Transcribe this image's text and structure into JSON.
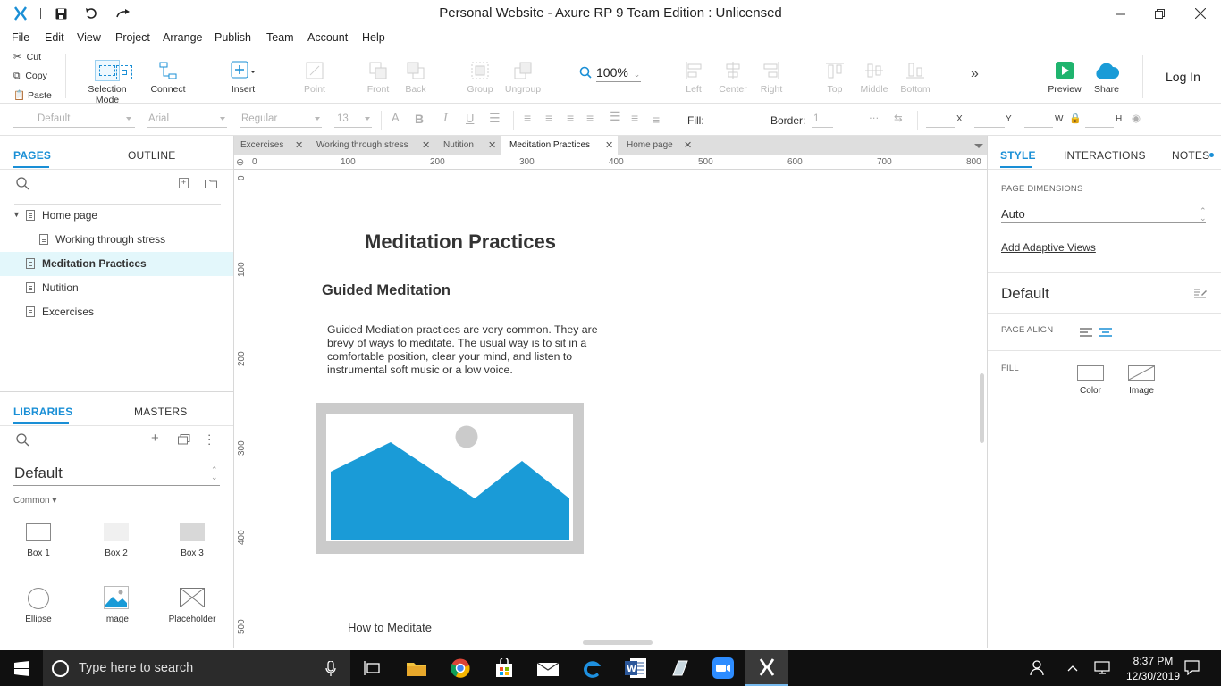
{
  "window": {
    "title": "Personal Website - Axure RP 9 Team Edition : Unlicensed",
    "app_logo": "axure-x-logo",
    "quick_access": [
      "save-icon",
      "undo-icon",
      "redo-icon"
    ],
    "controls": [
      "minimize",
      "restore",
      "close"
    ]
  },
  "menu": [
    "File",
    "Edit",
    "View",
    "Project",
    "Arrange",
    "Publish",
    "Team",
    "Account",
    "Help"
  ],
  "toolbar": {
    "edit": {
      "cut": "Cut",
      "copy": "Copy",
      "paste": "Paste"
    },
    "selection_mode": "Selection Mode",
    "connect": "Connect",
    "insert": "Insert",
    "point": "Point",
    "front": "Front",
    "back": "Back",
    "group": "Group",
    "ungroup": "Ungroup",
    "zoom": "100%",
    "left": "Left",
    "center": "Center",
    "right": "Right",
    "top": "Top",
    "middle": "Middle",
    "bottom": "Bottom",
    "more": "»",
    "preview": "Preview",
    "share": "Share",
    "login": "Log In"
  },
  "format": {
    "style": "Default",
    "font": "Arial",
    "weight": "Regular",
    "size": "13",
    "fill_label": "Fill:",
    "border_label": "Border:",
    "border_value": "1",
    "x": "X",
    "y": "Y",
    "w": "W",
    "h": "H"
  },
  "pages_panel": {
    "tab_pages": "PAGES",
    "tab_outline": "OUTLINE",
    "pages": [
      {
        "label": "Home page",
        "selected": false
      },
      {
        "label": "Working through stress",
        "selected": false
      },
      {
        "label": "Meditation Practices",
        "selected": true
      },
      {
        "label": "Nutition",
        "selected": false
      },
      {
        "label": "Excercises",
        "selected": false
      }
    ]
  },
  "libraries_panel": {
    "tab_libraries": "LIBRARIES",
    "tab_masters": "MASTERS",
    "library": "Default",
    "category": "Common ▾",
    "widgets": [
      "Box 1",
      "Box 2",
      "Box 3",
      "Ellipse",
      "Image",
      "Placeholder"
    ]
  },
  "doc_tabs": [
    "Excercises",
    "Working through stress",
    "Nutition",
    "Meditation Practices",
    "Home page"
  ],
  "active_doc_tab": "Meditation Practices",
  "ruler": {
    "horizontal": [
      "0",
      "100",
      "200",
      "300",
      "400",
      "500",
      "600",
      "700",
      "800"
    ],
    "vertical": [
      "0",
      "100",
      "200",
      "300",
      "400",
      "500"
    ]
  },
  "canvas": {
    "heading": "Meditation Practices",
    "subheading": "Guided Meditation",
    "paragraph": "Guided Mediation practices are very common. They are brevy of ways to meditate. The usual way is to sit in a comfortable position, clear your mind, and listen to instrumental soft music or a low voice.",
    "bottom_text": "How to  Meditate"
  },
  "style_panel": {
    "tab_style": "STYLE",
    "tab_interactions": "INTERACTIONS",
    "tab_notes": "NOTES",
    "page_dimensions_label": "PAGE DIMENSIONS",
    "page_dimensions_value": "Auto",
    "adaptive_link": "Add Adaptive Views",
    "style_name": "Default",
    "page_align_label": "PAGE ALIGN",
    "fill_label": "FILL",
    "fill_color": "Color",
    "fill_image": "Image"
  },
  "taskbar": {
    "search_placeholder": "Type here to search",
    "time": "8:37 PM",
    "date": "12/30/2019"
  },
  "colors": {
    "accent": "#1a8fd6",
    "selected_page": "#e3f7fb",
    "image_blue": "#1a9bd7",
    "preview_green": "#1fb46e"
  }
}
